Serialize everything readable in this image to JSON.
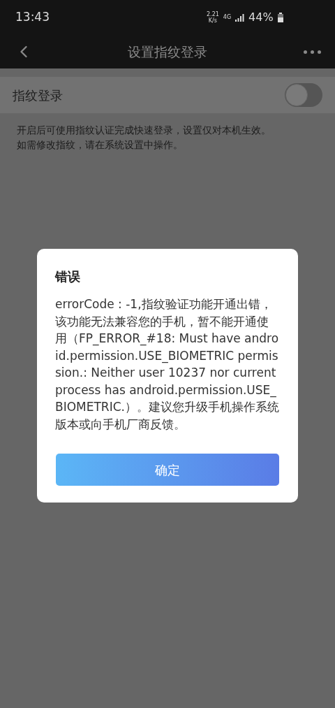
{
  "status_bar": {
    "time": "13:43",
    "speed_value": "2.21",
    "speed_unit": "K/s",
    "network": "4G",
    "battery": "44%"
  },
  "app_bar": {
    "title": "设置指纹登录"
  },
  "setting": {
    "label": "指纹登录",
    "on": false
  },
  "description": [
    "开启后可使用指纹认证完成快速登录，设置仅对本机生效。",
    "如需修改指纹，请在系统设置中操作。"
  ],
  "dialog": {
    "title": "错误",
    "message": "errorCode : -1,指纹验证功能开通出错，该功能无法兼容您的手机，暂不能开通使用（FP_ERROR_#18: Must have android.permission.USE_BIOMETRIC permission.: Neither user 10237 nor current process has android.permission.USE_BIOMETRIC.）。建议您升级手机操作系统版本或向手机厂商反馈。",
    "button": "确定"
  }
}
